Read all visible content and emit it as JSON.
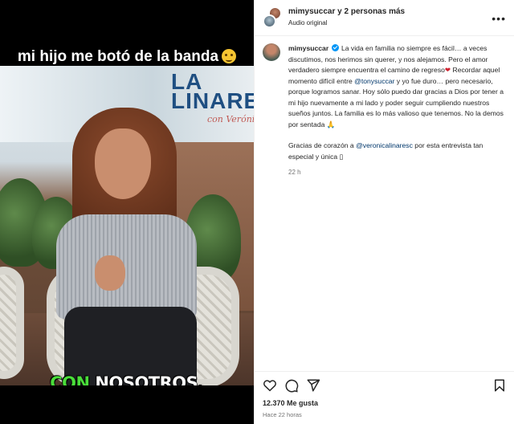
{
  "video": {
    "caption_top": "mi hijo me botó de la banda",
    "logo_line1": "LA",
    "logo_line2": "LINARE",
    "logo_sub": "con Verónica",
    "subtitle_highlight": "CON",
    "subtitle_rest": " NOSOTROS."
  },
  "header": {
    "username": "mimysuccar",
    "collab_text": " y 2 personas más",
    "audio": "Audio original",
    "more_icon": "more-dots-icon"
  },
  "post": {
    "username": "mimysuccar",
    "text_a": " La vida en familia no siempre es fácil… a veces discutimos, nos herimos sin querer, y nos alejamos. Pero el amor verdadero siempre encuentra el camino de regreso",
    "heart": "❤",
    "text_b": " Recordar aquel momento difícil entre ",
    "mention_1": "@tonysuccar",
    "text_c": " y yo fue duro… pero necesario, porque logramos sanar. Hoy sólo puedo dar gracias a Dios por tener a mi hijo nuevamente a mi lado y poder seguir cumpliendo nuestros sueños juntos. La familia es lo más valioso que tenemos. No la demos por sentada ",
    "pray": "🙏",
    "thanks_a": "Gracias de corazón a ",
    "mention_2": "@veronicalinaresc",
    "thanks_b": " por esta entrevista tan especial y única ",
    "box_glyph": "▯",
    "time": "22 h"
  },
  "footer": {
    "likes": "12.370 Me gusta",
    "ago": "Hace 22 horas"
  },
  "icons": [
    "like-icon",
    "comment-icon",
    "share-icon",
    "save-icon"
  ],
  "colors": {
    "link": "#00376b",
    "verified": "#0095f6",
    "subtitle_highlight": "#4ade3a"
  }
}
